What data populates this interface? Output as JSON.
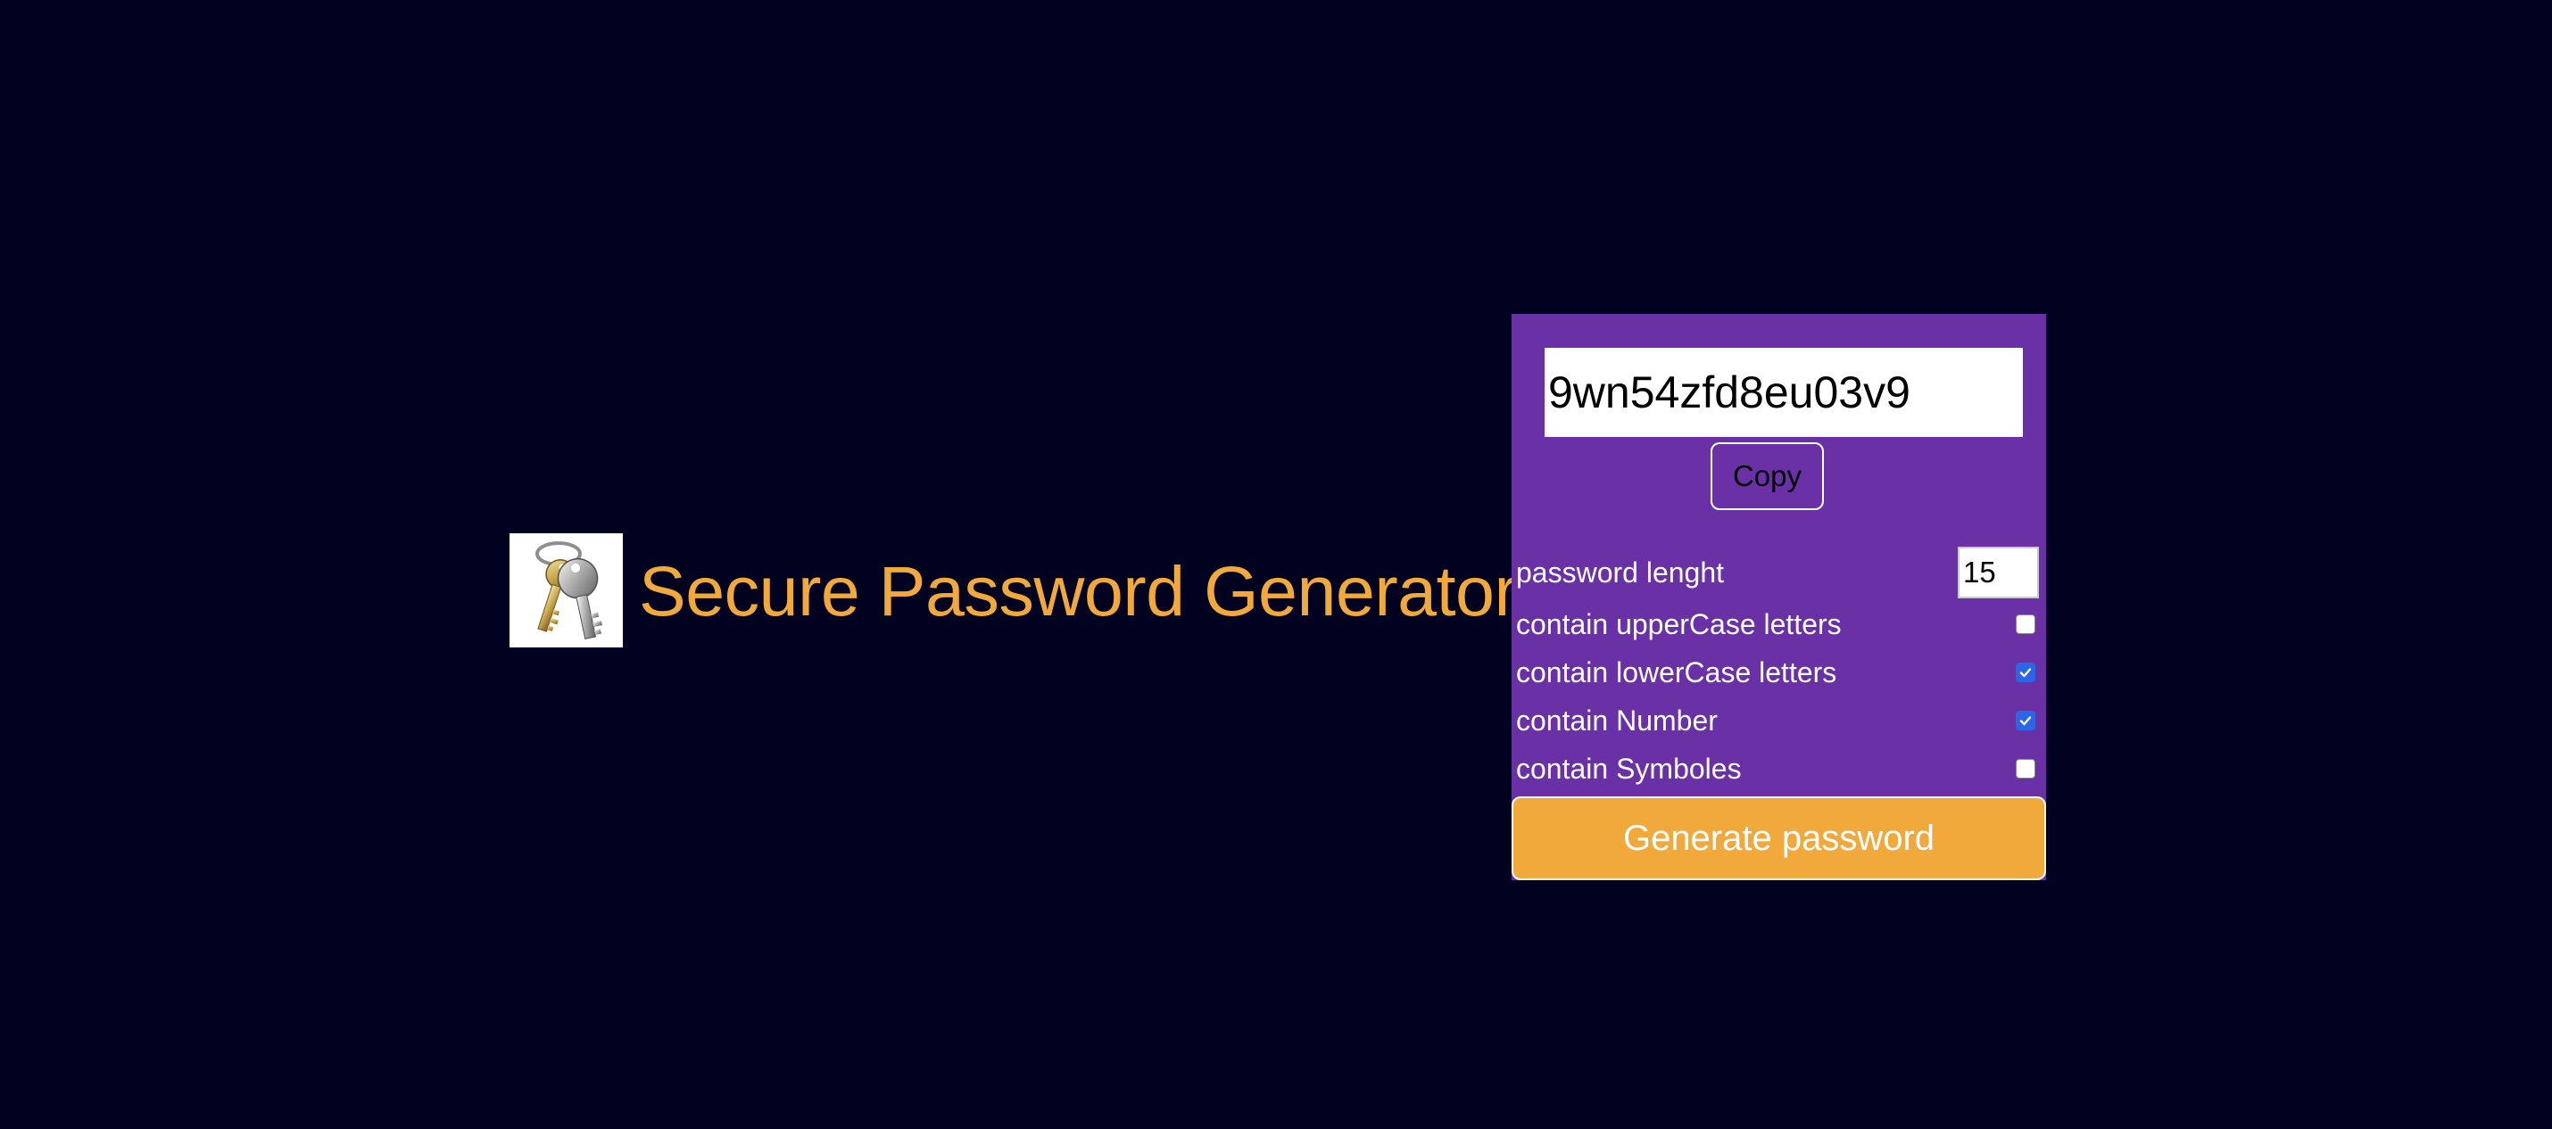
{
  "header": {
    "logo_icon": "keys-icon",
    "title": "Secure Password Generator"
  },
  "generator": {
    "password_value": "9wn54zfd8eu03v9",
    "copy_label": "Copy",
    "length_label": "password lenght",
    "length_value": "15",
    "options": [
      {
        "label": "contain upperCase letters",
        "checked": false
      },
      {
        "label": "contain lowerCase letters",
        "checked": true
      },
      {
        "label": "contain Number",
        "checked": true
      },
      {
        "label": "contain Symboles",
        "checked": false
      }
    ],
    "generate_label": "Generate password"
  },
  "colors": {
    "background": "#010220",
    "panel": "#6a30a6",
    "accent": "#f0a93a",
    "checkbox_checked": "#2a66e6"
  }
}
